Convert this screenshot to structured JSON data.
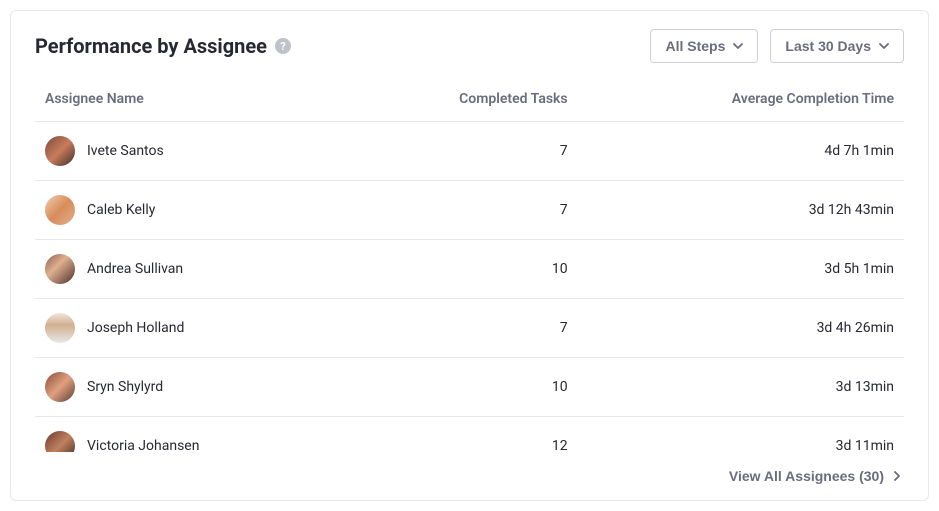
{
  "header": {
    "title": "Performance by Assignee",
    "help_icon": "?",
    "filter_steps": "All Steps",
    "filter_range": "Last 30 Days"
  },
  "columns": {
    "assignee": "Assignee Name",
    "completed": "Completed Tasks",
    "avg_time": "Average Completion Time"
  },
  "rows": [
    {
      "name": "Ivete Santos",
      "completed": "7",
      "avg_time": "4d 7h 1min",
      "avatar_bg": "linear-gradient(135deg,#7a4a3a 0%,#c97c5d 50%,#3a2e28 100%)"
    },
    {
      "name": "Caleb Kelly",
      "completed": "7",
      "avg_time": "3d 12h 43min",
      "avatar_bg": "linear-gradient(135deg,#f0d0b0 0%,#d98c5a 50%,#e0b090 100%)"
    },
    {
      "name": "Andrea Sullivan",
      "completed": "10",
      "avg_time": "3d 5h 1min",
      "avatar_bg": "linear-gradient(135deg,#8a5a4a 0%,#e0b090 40%,#4a2e28 100%)"
    },
    {
      "name": "Joseph Holland",
      "completed": "7",
      "avg_time": "3d 4h 26min",
      "avatar_bg": "linear-gradient(180deg,#f0e6dc 0%,#d0b090 40%,#e8e8e8 100%)"
    },
    {
      "name": "Sryn Shylyrd",
      "completed": "10",
      "avg_time": "3d 13min",
      "avatar_bg": "linear-gradient(135deg,#8a4a3a 0%,#e0a080 50%,#5a3a30 100%)"
    },
    {
      "name": "Victoria Johansen",
      "completed": "12",
      "avg_time": "3d 11min",
      "avatar_bg": "linear-gradient(135deg,#6a3a30 0%,#c08060 50%,#3a2820 100%)"
    }
  ],
  "footer": {
    "view_all": "View All Assignees (30)"
  }
}
